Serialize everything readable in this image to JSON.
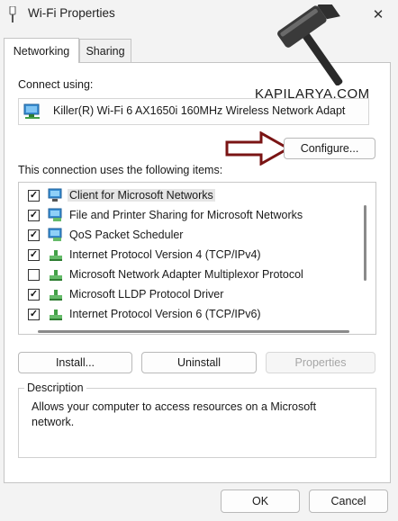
{
  "window": {
    "title": "Wi-Fi Properties",
    "close_glyph": "✕"
  },
  "tabs": [
    {
      "label": "Networking",
      "active": true
    },
    {
      "label": "Sharing",
      "active": false
    }
  ],
  "connect_using": {
    "label": "Connect using:",
    "adapter": "Killer(R) Wi-Fi 6 AX1650i 160MHz Wireless Network Adapt",
    "adapter_icon": "network-adapter-icon",
    "configure_label": "Configure..."
  },
  "items_label": "This connection uses the following items:",
  "items": [
    {
      "label": "Client for Microsoft Networks",
      "checked": true,
      "icon": "client-icon",
      "selected": true
    },
    {
      "label": "File and Printer Sharing for Microsoft Networks",
      "checked": true,
      "icon": "sharing-icon"
    },
    {
      "label": "QoS Packet Scheduler",
      "checked": true,
      "icon": "scheduler-icon"
    },
    {
      "label": "Internet Protocol Version 4 (TCP/IPv4)",
      "checked": true,
      "icon": "protocol-icon"
    },
    {
      "label": "Microsoft Network Adapter Multiplexor Protocol",
      "checked": false,
      "icon": "protocol-icon"
    },
    {
      "label": "Microsoft LLDP Protocol Driver",
      "checked": true,
      "icon": "protocol-icon"
    },
    {
      "label": "Internet Protocol Version 6 (TCP/IPv6)",
      "checked": true,
      "icon": "protocol-icon"
    }
  ],
  "buttons": {
    "install": "Install...",
    "uninstall": "Uninstall",
    "properties": "Properties",
    "ok": "OK",
    "cancel": "Cancel"
  },
  "description": {
    "title": "Description",
    "text": "Allows your computer to access resources on a Microsoft network."
  },
  "watermark": {
    "text": "KAPILARYA.COM",
    "icon": "hammer-logo-icon"
  },
  "colors": {
    "accent_arrow": "#7a1414",
    "background": "#f3f3f3",
    "panel": "#ffffff"
  }
}
